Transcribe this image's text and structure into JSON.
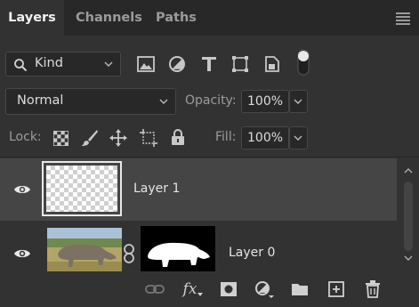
{
  "panel": {
    "tabs": [
      {
        "label": "Layers"
      },
      {
        "label": "Channels"
      },
      {
        "label": "Paths"
      }
    ]
  },
  "filter": {
    "kind_label": "Kind",
    "type_icons": [
      "image-filter-icon",
      "adjustment-filter-icon",
      "type-filter-icon",
      "shape-filter-icon",
      "smart-object-filter-icon",
      "filter-toggle-icon"
    ]
  },
  "blend": {
    "mode": "Normal",
    "opacity_label": "Opacity:",
    "opacity_value": "100%"
  },
  "lock": {
    "label": "Lock:",
    "fill_label": "Fill:",
    "fill_value": "100%"
  },
  "layers": [
    {
      "name": "Layer 1",
      "visible": true,
      "selected": true
    },
    {
      "name": "Layer 0",
      "visible": true,
      "selected": false,
      "has_mask": true
    }
  ],
  "footer": {
    "fx_label": "fx"
  },
  "colors": {
    "panel_bg": "#323232",
    "tab_bar_bg": "#282828",
    "selected_row": "#454545",
    "icon": "#c8c8c8"
  }
}
